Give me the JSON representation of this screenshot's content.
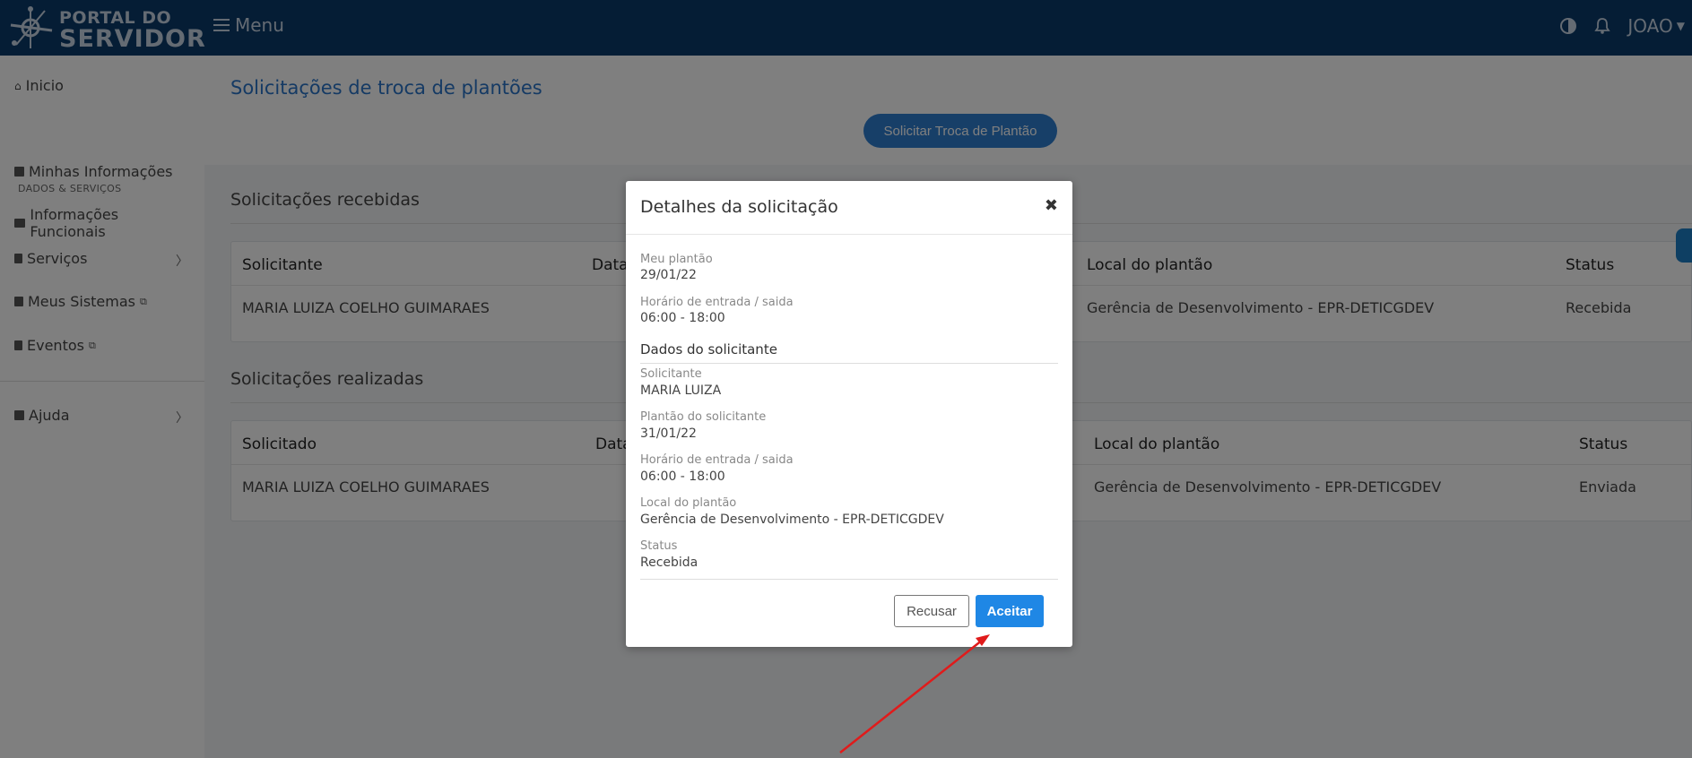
{
  "header": {
    "logo_small": "PORTAL DO",
    "logo_big": "SERVIDOR",
    "menu_label": "Menu",
    "user_name": "JOAO",
    "icons": [
      "contrast-icon",
      "bell-icon",
      "caret-down-icon",
      "hamburger-icon"
    ]
  },
  "sidebar": {
    "home": "Inicio",
    "section_label": "DADOS & SERVIÇOS",
    "items": [
      {
        "label": "Minhas Informações",
        "icon": "person-card-icon"
      },
      {
        "label": "Informações Funcionais",
        "icon": "id-card-icon"
      },
      {
        "label": "Serviços",
        "icon": "document-icon"
      },
      {
        "label": "Meus Sistemas",
        "icon": "copy-icon"
      },
      {
        "label": "Eventos",
        "icon": "book-icon"
      }
    ],
    "help": "Ajuda"
  },
  "main": {
    "page_title": "Solicitações de troca de plantões",
    "request_button": "Solicitar Troca de Plantão",
    "received": {
      "title": "Solicitações recebidas",
      "headers": [
        "Solicitante",
        "Data",
        "Local do plantão",
        "Status"
      ],
      "row": {
        "solicitante": "MARIA LUIZA COELHO GUIMARAES",
        "local": "Gerência de Desenvolvimento - EPR-DETICGDEV",
        "status": "Recebida"
      }
    },
    "made": {
      "title": "Solicitações realizadas",
      "headers": [
        "Solicitado",
        "Data",
        "Local do plantão",
        "Status"
      ],
      "row": {
        "solicitado": "MARIA LUIZA COELHO GUIMARAES",
        "local": "Gerência de Desenvolvimento - EPR-DETICGDEV",
        "status": "Enviada"
      }
    }
  },
  "modal": {
    "title": "Detalhes da solicitação",
    "close": "✖",
    "meu_plantao_label": "Meu plantão",
    "meu_plantao_value": "29/01/22",
    "horario_label": "Horário de entrada / saida",
    "horario_value": "06:00 - 18:00",
    "subsection": "Dados do solicitante",
    "solicitante_label": "Solicitante",
    "solicitante_value": "MARIA LUIZA",
    "plantao_solicitante_label": "Plantão do solicitante",
    "plantao_solicitante_value": "31/01/22",
    "horario2_label": "Horário de entrada / saida",
    "horario2_value": "06:00 - 18:00",
    "local_label": "Local do plantão",
    "local_value": "Gerência de Desenvolvimento - EPR-DETICGDEV",
    "status_label": "Status",
    "status_value": "Recebida",
    "reject_button": "Recusar",
    "accept_button": "Aceitar"
  },
  "colors": {
    "topbar": "#0b3a6b",
    "accent": "#1f87e5",
    "link": "#2a75c9",
    "annotation_arrow": "#e01b1b"
  }
}
